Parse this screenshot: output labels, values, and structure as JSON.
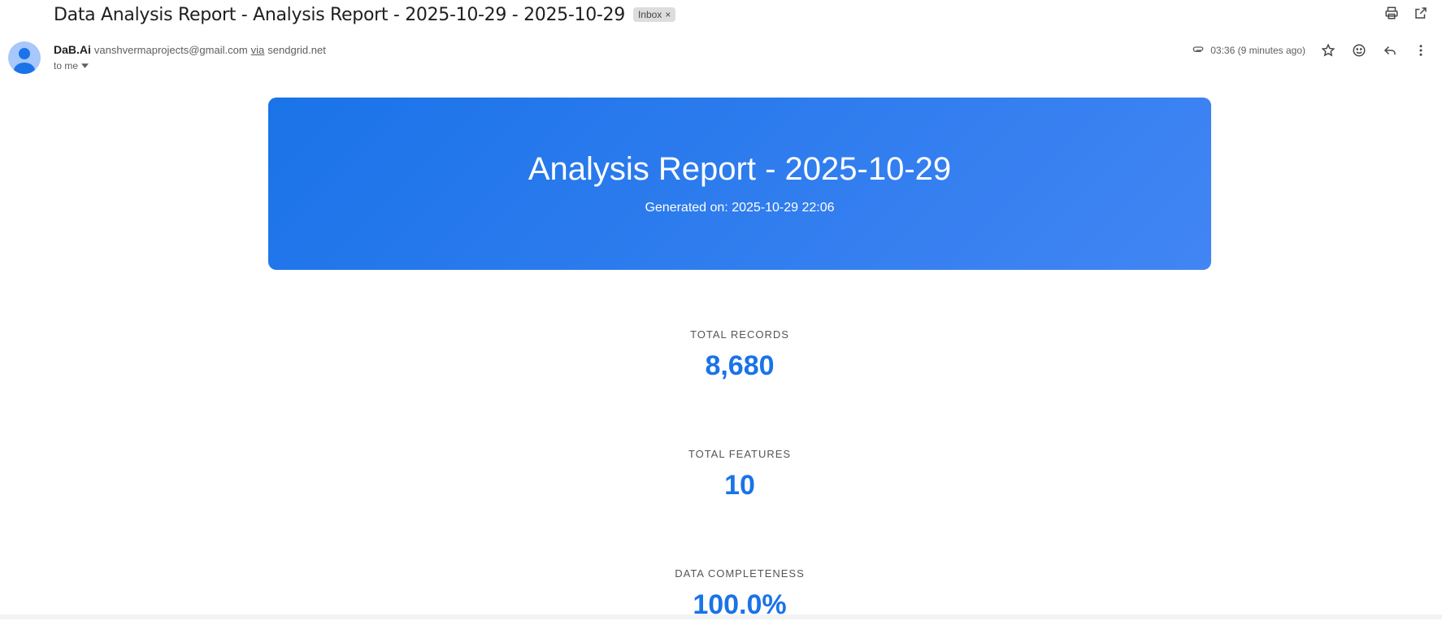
{
  "email": {
    "subject": "Data Analysis Report - Analysis Report - 2025-10-29 - 2025-10-29",
    "label": "Inbox",
    "label_remove": "×",
    "sender_name": "DaB.Ai",
    "sender_email": "vanshvermaprojects@gmail.com",
    "via": "via",
    "via_domain": "sendgrid.net",
    "to": "to me",
    "time": "03:36 (9 minutes ago)"
  },
  "report": {
    "title": "Analysis Report - 2025-10-29",
    "generated": "Generated on: 2025-10-29 22:06",
    "stats": [
      {
        "label": "TOTAL RECORDS",
        "value": "8,680"
      },
      {
        "label": "TOTAL FEATURES",
        "value": "10"
      },
      {
        "label": "DATA COMPLETENESS",
        "value": "100.0%"
      }
    ]
  },
  "icons": [
    "print-icon",
    "open-new-window-icon",
    "attachment-icon",
    "star-icon",
    "emoji-icon",
    "reply-icon",
    "more-vert-icon",
    "chevron-down-icon",
    "avatar-person-icon"
  ],
  "colors": {
    "accent": "#1a73e8",
    "banner_start": "#1a73e8",
    "banner_end": "#4285f4",
    "chip_bg": "#dddddd"
  }
}
